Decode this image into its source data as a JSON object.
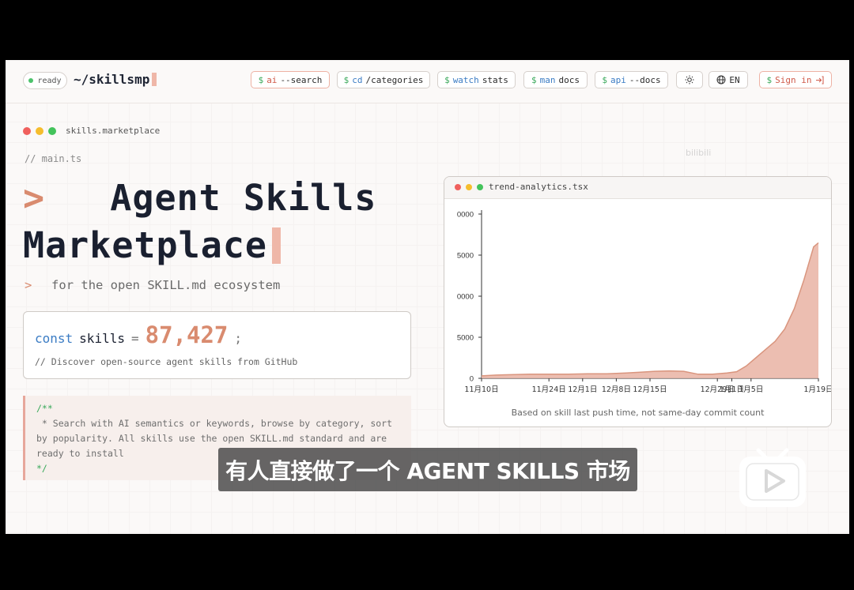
{
  "nav": {
    "status": "ready",
    "brand": "~/skillsmp",
    "commands": [
      {
        "dollar": "$",
        "kw": "ai",
        "rest": "--search"
      },
      {
        "dollar": "$",
        "kw": "cd",
        "rest": "/categories"
      },
      {
        "dollar": "$",
        "kw": "watch",
        "rest": "stats"
      },
      {
        "dollar": "$",
        "kw": "man",
        "rest": "docs"
      },
      {
        "dollar": "$",
        "kw": "api",
        "rest": "--docs"
      }
    ],
    "theme_icon": "sun-icon",
    "lang": "EN",
    "signin": {
      "dollar": "$",
      "label": "Sign in"
    }
  },
  "terminal": {
    "title": "skills.marketplace"
  },
  "hero": {
    "file": "// main.ts",
    "prompt": ">",
    "title_line1": "Agent Skills",
    "title_line2": "Marketplace",
    "subtitle_prompt": ">",
    "subtitle": "for the open SKILL.md ecosystem"
  },
  "stats": {
    "const_kw": "const",
    "var": "skills",
    "eq": "=",
    "count": "87,427",
    "semi": ";",
    "comment": "// Discover open-source agent skills from GitHub"
  },
  "doc": {
    "open": "/**",
    "line1": " * Search with AI semantics or keywords, browse by category, sort",
    "line2": "by popularity. All skills use the open SKILL.md standard and are",
    "line3": "ready to install",
    "close": "*/"
  },
  "chart_data": {
    "type": "area",
    "title": "trend-analytics.tsx",
    "caption": "Based on skill last push time, not same-day commit count",
    "x_labels": [
      "11月10日",
      "11月24日",
      "12月1日",
      "12月8日",
      "12月15日",
      "12月29日",
      "1月1日",
      "1月5日",
      "1月19日"
    ],
    "x_label_days": [
      0,
      14,
      21,
      28,
      35,
      49,
      52,
      56,
      70
    ],
    "y_ticks": [
      "0",
      "5000",
      "0000",
      "5000",
      "0000"
    ],
    "y_values": [
      0,
      5000,
      10000,
      15000,
      20000
    ],
    "ylim": [
      0,
      20000
    ],
    "x": [
      0,
      3,
      6,
      10,
      14,
      18,
      22,
      26,
      28,
      30,
      33,
      36,
      39,
      42,
      45,
      48,
      51,
      53,
      55,
      57,
      59,
      61,
      63,
      65,
      67,
      69,
      70
    ],
    "y": [
      300,
      400,
      450,
      500,
      500,
      500,
      550,
      550,
      600,
      650,
      750,
      850,
      900,
      850,
      500,
      500,
      650,
      800,
      1500,
      2500,
      3500,
      4500,
      6000,
      8500,
      12000,
      16000,
      16500
    ],
    "fill_color": "#e9b3a3",
    "line_color": "#d9957e"
  },
  "overlay": {
    "subtitle": "有人直接做了一个 AGENT SKILLS 市场",
    "watermark": "bilibili"
  }
}
